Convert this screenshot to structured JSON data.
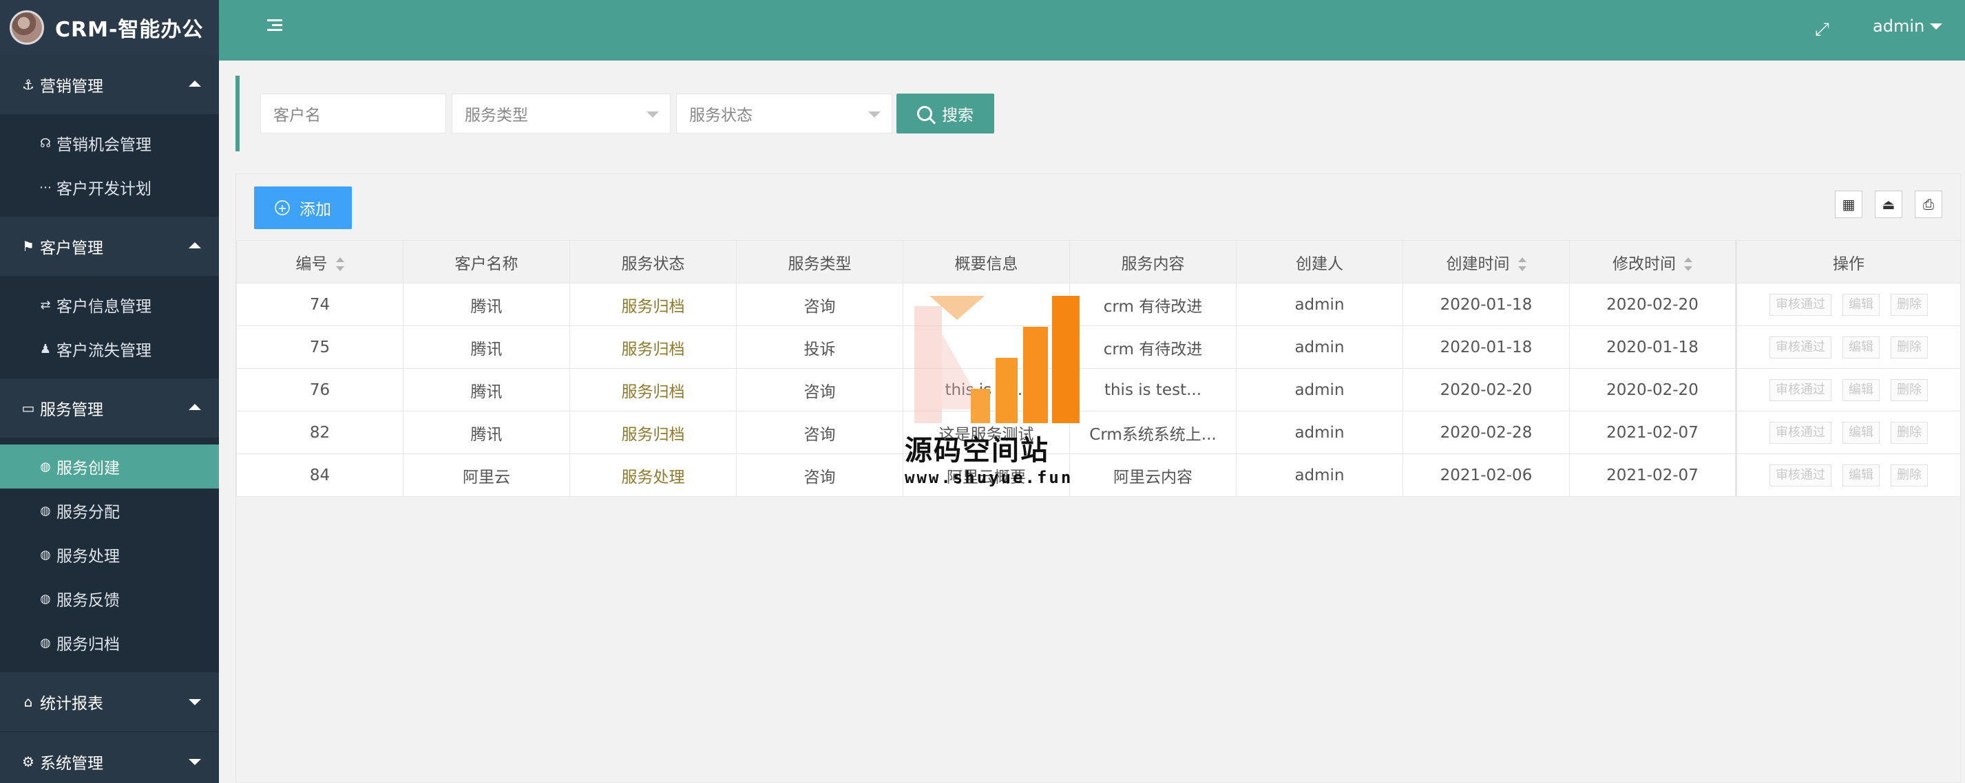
{
  "app": {
    "title": "CRM-智能办公"
  },
  "sidebar": {
    "groups": [
      {
        "label": "营销管理",
        "icon": "anchor-icon",
        "expanded": true,
        "items": [
          {
            "label": "营销机会管理",
            "icon": "tachometer-icon"
          },
          {
            "label": "客户开发计划",
            "icon": "ellipsis-icon"
          }
        ]
      },
      {
        "label": "客户管理",
        "icon": "flag-icon",
        "expanded": true,
        "items": [
          {
            "label": "客户信息管理",
            "icon": "exchange-icon"
          },
          {
            "label": "客户流失管理",
            "icon": "user-times-icon"
          }
        ]
      },
      {
        "label": "服务管理",
        "icon": "desktop-icon",
        "expanded": true,
        "items": [
          {
            "label": "服务创建",
            "icon": "dashboard-icon",
            "active": true
          },
          {
            "label": "服务分配",
            "icon": "dashboard-icon"
          },
          {
            "label": "服务处理",
            "icon": "dashboard-icon"
          },
          {
            "label": "服务反馈",
            "icon": "dashboard-icon"
          },
          {
            "label": "服务归档",
            "icon": "dashboard-icon"
          }
        ]
      },
      {
        "label": "统计报表",
        "icon": "home-icon",
        "expanded": false,
        "items": []
      },
      {
        "label": "系统管理",
        "icon": "cogs-icon",
        "expanded": false,
        "items": []
      }
    ]
  },
  "topbar": {
    "user": "admin"
  },
  "search": {
    "customer_placeholder": "客户名",
    "service_type_placeholder": "服务类型",
    "service_status_placeholder": "服务状态",
    "button_label": "搜索"
  },
  "toolbar": {
    "add_label": "添加"
  },
  "table": {
    "columns": [
      "编号",
      "客户名称",
      "服务状态",
      "服务类型",
      "概要信息",
      "服务内容",
      "创建人",
      "创建时间",
      "修改时间",
      "操作"
    ],
    "rows": [
      {
        "id": "74",
        "customer": "腾讯",
        "status": "服务归档",
        "type": "咨询",
        "summary": "",
        "content": "crm 有待改进",
        "creator": "admin",
        "created": "2020-01-18",
        "modified": "2020-02-20"
      },
      {
        "id": "75",
        "customer": "腾讯",
        "status": "服务归档",
        "type": "投诉",
        "summary": "",
        "content": "crm 有待改进",
        "creator": "admin",
        "created": "2020-01-18",
        "modified": "2020-01-18"
      },
      {
        "id": "76",
        "customer": "腾讯",
        "status": "服务归档",
        "type": "咨询",
        "summary": "this is te...",
        "content": "this is test...",
        "creator": "admin",
        "created": "2020-02-20",
        "modified": "2020-02-20"
      },
      {
        "id": "82",
        "customer": "腾讯",
        "status": "服务归档",
        "type": "咨询",
        "summary": "这是服务测试",
        "content": "Crm系统系统上...",
        "creator": "admin",
        "created": "2020-02-28",
        "modified": "2021-02-07"
      },
      {
        "id": "84",
        "customer": "阿里云",
        "status": "服务处理",
        "type": "咨询",
        "summary": "阿里云概要",
        "content": "阿里云内容",
        "creator": "admin",
        "created": "2021-02-06",
        "modified": "2021-02-07"
      }
    ],
    "actions": [
      "审核通过",
      "编辑",
      "删除"
    ]
  },
  "watermark": {
    "title": "源码空间站",
    "url": "www.shuyue.fun"
  },
  "colors": {
    "sidebar": "#2f4050",
    "primary": "#4a9f93",
    "add": "#3ea3f8",
    "status": "#8d7a2e"
  }
}
